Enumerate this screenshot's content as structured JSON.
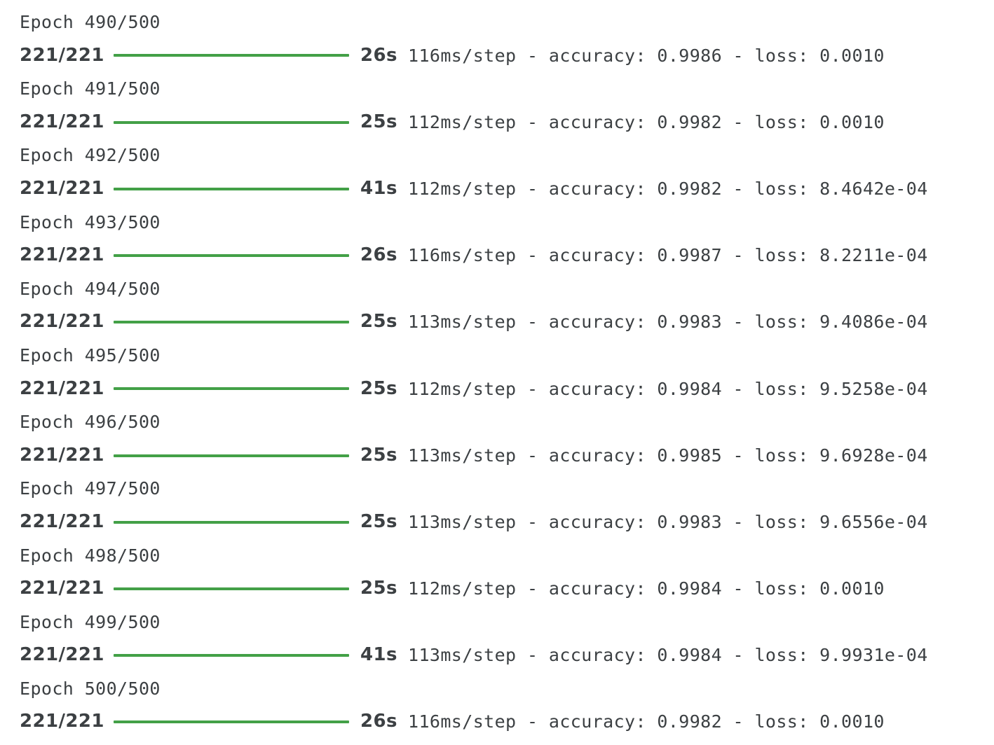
{
  "log": {
    "accent_color": "#43a047",
    "entries": [
      {
        "epoch": "Epoch 490/500",
        "steps": "221/221",
        "progress": 1.0,
        "time": "26s",
        "metrics": "116ms/step - accuracy: 0.9986 - loss: 0.0010"
      },
      {
        "epoch": "Epoch 491/500",
        "steps": "221/221",
        "progress": 1.0,
        "time": "25s",
        "metrics": "112ms/step - accuracy: 0.9982 - loss: 0.0010"
      },
      {
        "epoch": "Epoch 492/500",
        "steps": "221/221",
        "progress": 1.0,
        "time": "41s",
        "metrics": "112ms/step - accuracy: 0.9982 - loss: 8.4642e-04"
      },
      {
        "epoch": "Epoch 493/500",
        "steps": "221/221",
        "progress": 1.0,
        "time": "26s",
        "metrics": "116ms/step - accuracy: 0.9987 - loss: 8.2211e-04"
      },
      {
        "epoch": "Epoch 494/500",
        "steps": "221/221",
        "progress": 1.0,
        "time": "25s",
        "metrics": "113ms/step - accuracy: 0.9983 - loss: 9.4086e-04"
      },
      {
        "epoch": "Epoch 495/500",
        "steps": "221/221",
        "progress": 1.0,
        "time": "25s",
        "metrics": "112ms/step - accuracy: 0.9984 - loss: 9.5258e-04"
      },
      {
        "epoch": "Epoch 496/500",
        "steps": "221/221",
        "progress": 1.0,
        "time": "25s",
        "metrics": "113ms/step - accuracy: 0.9985 - loss: 9.6928e-04"
      },
      {
        "epoch": "Epoch 497/500",
        "steps": "221/221",
        "progress": 1.0,
        "time": "25s",
        "metrics": "113ms/step - accuracy: 0.9983 - loss: 9.6556e-04"
      },
      {
        "epoch": "Epoch 498/500",
        "steps": "221/221",
        "progress": 1.0,
        "time": "25s",
        "metrics": "112ms/step - accuracy: 0.9984 - loss: 0.0010"
      },
      {
        "epoch": "Epoch 499/500",
        "steps": "221/221",
        "progress": 1.0,
        "time": "41s",
        "metrics": "113ms/step - accuracy: 0.9984 - loss: 9.9931e-04"
      },
      {
        "epoch": "Epoch 500/500",
        "steps": "221/221",
        "progress": 1.0,
        "time": "26s",
        "metrics": "116ms/step - accuracy: 0.9982 - loss: 0.0010"
      }
    ]
  }
}
